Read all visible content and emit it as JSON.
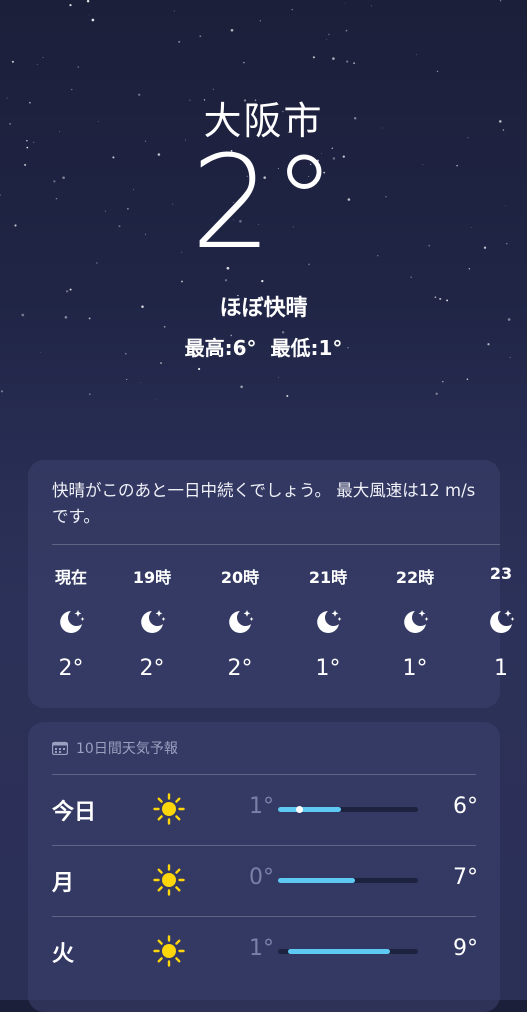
{
  "location": {
    "city": "大阪市",
    "temperature": "2°",
    "condition": "ほぼ快晴",
    "high": "最高:6°",
    "low": "最低:1°"
  },
  "hourly": {
    "summary": "快晴がこのあと一日中続くでしょう。 最大風速は12 m/s です。",
    "items": [
      {
        "time": "現在",
        "icon": "moon-stars-icon",
        "temp": "2°"
      },
      {
        "time": "19時",
        "icon": "moon-stars-icon",
        "temp": "2°"
      },
      {
        "time": "20時",
        "icon": "moon-stars-icon",
        "temp": "2°"
      },
      {
        "time": "21時",
        "icon": "moon-stars-icon",
        "temp": "1°"
      },
      {
        "time": "22時",
        "icon": "moon-stars-icon",
        "temp": "1°"
      },
      {
        "time": "23",
        "icon": "moon-stars-icon",
        "temp": "1"
      }
    ]
  },
  "daily": {
    "title": "10日間天気予報",
    "icon": "calendar-icon",
    "days": [
      {
        "day": "今日",
        "icon": "sun-icon",
        "low": "1°",
        "high": "6°",
        "range_start": 0.0,
        "range_end": 0.45,
        "current_marker": 0.15
      },
      {
        "day": "月",
        "icon": "sun-icon",
        "low": "0°",
        "high": "7°",
        "range_start": 0.0,
        "range_end": 0.55
      },
      {
        "day": "火",
        "icon": "sun-icon",
        "low": "1°",
        "high": "9°",
        "range_start": 0.07,
        "range_end": 0.8
      }
    ]
  },
  "colors": {
    "range_bar": "#5ec9f2",
    "sun": "#ffd60a",
    "low_text": "#7b80a6"
  }
}
